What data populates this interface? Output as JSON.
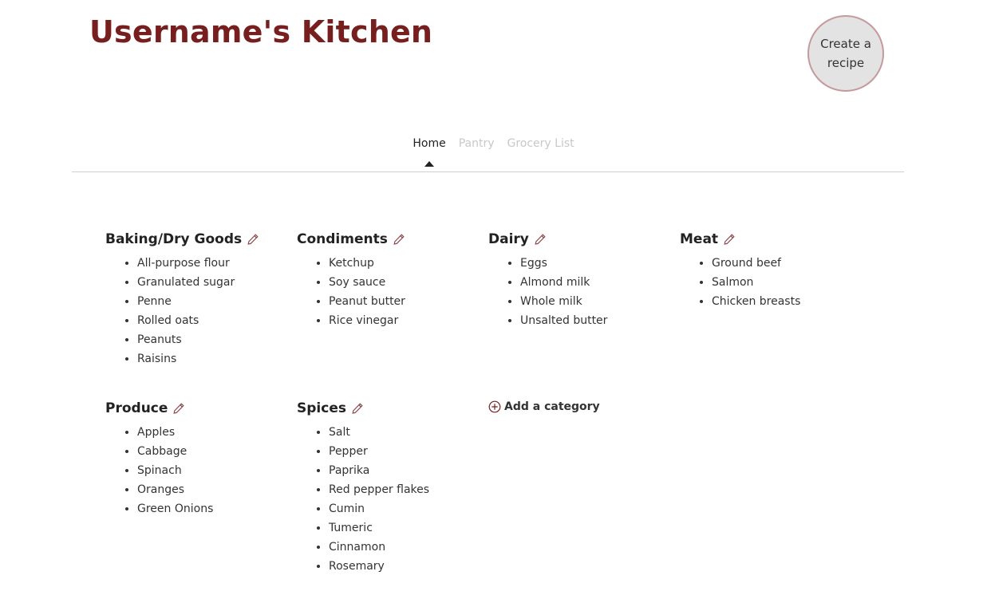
{
  "header": {
    "title": "Username's Kitchen",
    "create_recipe_label": "Create a recipe"
  },
  "nav": {
    "tabs": [
      {
        "label": "Home",
        "active": true
      },
      {
        "label": "Pantry",
        "active": false
      },
      {
        "label": "Grocery List",
        "active": false
      }
    ]
  },
  "colors": {
    "brand": "#771e1e",
    "edit_icon": "#8a4a4e",
    "inactive_tab": "#c8c8c8"
  },
  "categories": [
    {
      "name": "Baking/Dry Goods",
      "icon": "pencil-icon",
      "items": [
        "All-purpose flour",
        "Granulated sugar",
        "Penne",
        "Rolled oats",
        "Peanuts",
        "Raisins"
      ]
    },
    {
      "name": "Condiments",
      "icon": "pencil-icon",
      "items": [
        "Ketchup",
        "Soy sauce",
        "Peanut butter",
        "Rice vinegar"
      ]
    },
    {
      "name": "Dairy",
      "icon": "pencil-icon",
      "items": [
        "Eggs",
        "Almond milk",
        "Whole milk",
        "Unsalted butter"
      ]
    },
    {
      "name": "Meat",
      "icon": "pencil-icon",
      "items": [
        "Ground beef",
        "Salmon",
        "Chicken breasts"
      ]
    },
    {
      "name": "Produce",
      "icon": "pencil-icon",
      "items": [
        "Apples",
        "Cabbage",
        "Spinach",
        "Oranges",
        "Green Onions"
      ]
    },
    {
      "name": "Spices",
      "icon": "pencil-icon",
      "items": [
        "Salt",
        "Pepper",
        "Paprika",
        "Red pepper flakes",
        "Cumin",
        "Tumeric",
        "Cinnamon",
        "Rosemary"
      ]
    }
  ],
  "add_category": {
    "label": "Add a category",
    "icon": "plus-circle-icon"
  }
}
